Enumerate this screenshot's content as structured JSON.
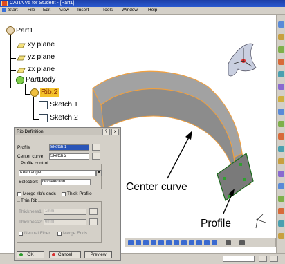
{
  "window": {
    "title": "CATIA V5 for Student - [Part1]"
  },
  "menu": {
    "items": [
      "Start",
      "File",
      "Edit",
      "View",
      "Insert",
      "Tools",
      "Window",
      "Help"
    ]
  },
  "tree": {
    "root": "Part1",
    "planes": [
      "xy plane",
      "yz plane",
      "zx plane"
    ],
    "body": "PartBody",
    "feature": "Rib.2",
    "sketches": [
      "Sketch.1",
      "Sketch.2"
    ]
  },
  "dialog": {
    "title": "Rib Definition",
    "help": "?",
    "close": "x",
    "profile_label": "Profile",
    "profile_value": "Sketch.1",
    "center_label": "Center curve",
    "center_value": "Sketch.2",
    "profile_control_label": "Profile control",
    "profile_control_value": "Keep angle",
    "selection_label": "Selection:",
    "selection_value": "No selection",
    "merge_ends": "Merge rib's ends",
    "thick_profile": "Thick Profile",
    "thin_rib_label": "Thin Rib",
    "thickness1_label": "Thickness1:",
    "thickness1_value": "1mm",
    "thickness2_label": "Thickness2:",
    "thickness2_value": "0mm",
    "neutral_fiber": "Neutral Fiber",
    "merge_ends2": "Merge Ends",
    "ok": "OK",
    "cancel": "Cancel",
    "preview": "Preview"
  },
  "annotations": {
    "center_curve": "Center curve",
    "profile": "Profile"
  },
  "colors": {
    "titlebar": "#1c3fa8",
    "rib_fill": "#8c8c8c",
    "rib_highlight": "#f0a040",
    "tree_gear": "#7fcc4a"
  }
}
